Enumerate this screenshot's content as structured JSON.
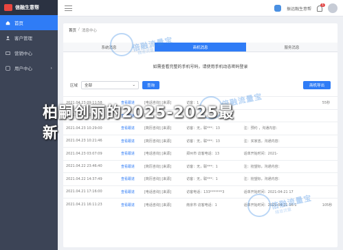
{
  "sidebar": {
    "brand": "信融生意帮",
    "items": [
      {
        "label": "首页"
      },
      {
        "label": "客户管理"
      },
      {
        "label": "营销中心"
      },
      {
        "label": "用户中心"
      }
    ]
  },
  "topbar": {
    "user_name": "振远融生意帮",
    "notification_count": "1"
  },
  "breadcrumb": {
    "home": "首页",
    "current": "消息中心"
  },
  "tabs": [
    {
      "label": "系统消息"
    },
    {
      "label": "商机消息"
    },
    {
      "label": "服务消息"
    }
  ],
  "notice": "如需查看完整的手机号码，请使用手机动态密码登录",
  "filter": {
    "label": "区域",
    "selected": "全部",
    "search_btn": "查询",
    "export_btn": "商机导出"
  },
  "table": {
    "rows": [
      {
        "time": "2021.04.23 09:11:58",
        "action": "查看跟进",
        "channel": "[电话咨询] [来源]",
        "info": "访客：1",
        "extra": "",
        "follow": "",
        "duration": "",
        "dur2": "55秒"
      },
      {
        "time": "2021.04.23 10:4",
        "action": "查看跟进",
        "channel": "[",
        "info": "",
        "extra": "",
        "follow": "",
        "duration": "",
        "dur2": ""
      },
      {
        "time": "2021.04.23 10:29:00",
        "action": "查看跟进",
        "channel": "[简历咨询] [来源]",
        "info": "访客：无，联***：13",
        "extra": "：",
        "follow": "注：预约 ，沟通内容：",
        "duration": "",
        "dur2": ""
      },
      {
        "time": "2021.04.23 10:21:46",
        "action": "查看跟进",
        "channel": "[简历咨询] [来源]",
        "info": "访客：无，联***：13",
        "extra": "",
        "follow": "注：买家咨，沟通内容：",
        "duration": "",
        "dur2": ""
      },
      {
        "time": "2021.04.23 03:07:09",
        "action": "查看跟进",
        "channel": "[电话咨询] [来源]",
        "info": "郑州市 访客电话：13",
        "extra": "",
        "follow": "话单开始时间：2021-",
        "duration": "",
        "dur2": ""
      },
      {
        "time": "2021.04.22 23:46:40",
        "action": "查看跟进",
        "channel": "[简历咨询] [来源]",
        "info": "访客：无，联***：1",
        "extra": "",
        "follow": "注：抢望标，沟通内容：",
        "duration": "",
        "dur2": ""
      },
      {
        "time": "2021.04.22 14:37:49",
        "action": "查看跟进",
        "channel": "[简历咨询] [来源]",
        "info": "访客：无，联***：1",
        "extra": "",
        "follow": "注：抢望标，沟通内容：",
        "duration": "",
        "dur2": ""
      },
      {
        "time": "2021.04.21 17:16:00",
        "action": "查看跟进",
        "channel": "[电话咨询] [来源]",
        "info": "访客电话：133*******3",
        "extra": "",
        "follow": "话单开始时间：2021-04-21 17",
        "duration": "",
        "dur2": ""
      },
      {
        "time": "2021.04.21 16:11:23",
        "action": "查看跟进",
        "channel": "[电话咨询] [来源]",
        "info": "南京市 访客电话：1",
        "extra": "",
        "follow": "话单开始时间：2021-04-21 16:1",
        "duration": "",
        "dur2": "105秒"
      }
    ]
  },
  "watermark": {
    "brand": "倍融流量宝",
    "sub": "精准流量"
  },
  "headline": {
    "line1": "柏嗣创丽的2025-2025最",
    "line2": "新"
  }
}
